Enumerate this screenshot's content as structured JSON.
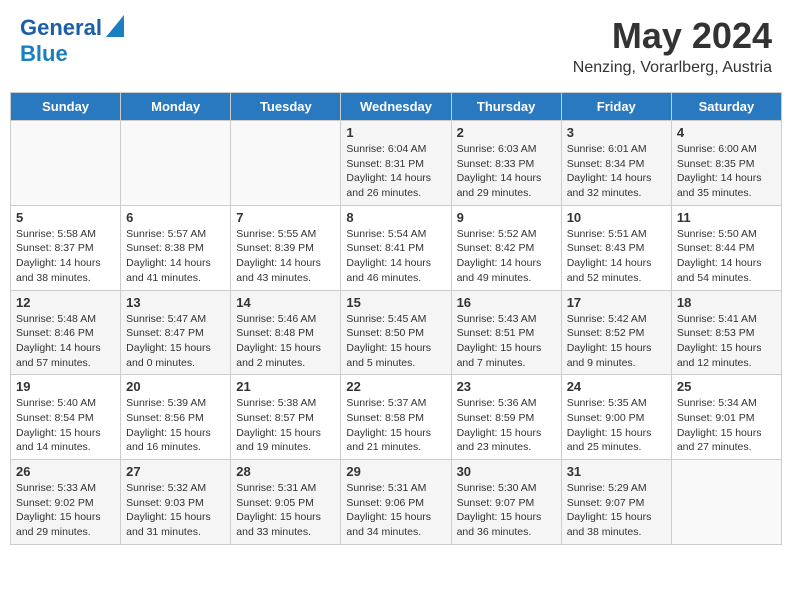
{
  "header": {
    "logo_line1": "General",
    "logo_line2": "Blue",
    "month_title": "May 2024",
    "location": "Nenzing, Vorarlberg, Austria"
  },
  "days_of_week": [
    "Sunday",
    "Monday",
    "Tuesday",
    "Wednesday",
    "Thursday",
    "Friday",
    "Saturday"
  ],
  "weeks": [
    [
      {
        "day": "",
        "info": ""
      },
      {
        "day": "",
        "info": ""
      },
      {
        "day": "",
        "info": ""
      },
      {
        "day": "1",
        "info": "Sunrise: 6:04 AM\nSunset: 8:31 PM\nDaylight: 14 hours and 26 minutes."
      },
      {
        "day": "2",
        "info": "Sunrise: 6:03 AM\nSunset: 8:33 PM\nDaylight: 14 hours and 29 minutes."
      },
      {
        "day": "3",
        "info": "Sunrise: 6:01 AM\nSunset: 8:34 PM\nDaylight: 14 hours and 32 minutes."
      },
      {
        "day": "4",
        "info": "Sunrise: 6:00 AM\nSunset: 8:35 PM\nDaylight: 14 hours and 35 minutes."
      }
    ],
    [
      {
        "day": "5",
        "info": "Sunrise: 5:58 AM\nSunset: 8:37 PM\nDaylight: 14 hours and 38 minutes."
      },
      {
        "day": "6",
        "info": "Sunrise: 5:57 AM\nSunset: 8:38 PM\nDaylight: 14 hours and 41 minutes."
      },
      {
        "day": "7",
        "info": "Sunrise: 5:55 AM\nSunset: 8:39 PM\nDaylight: 14 hours and 43 minutes."
      },
      {
        "day": "8",
        "info": "Sunrise: 5:54 AM\nSunset: 8:41 PM\nDaylight: 14 hours and 46 minutes."
      },
      {
        "day": "9",
        "info": "Sunrise: 5:52 AM\nSunset: 8:42 PM\nDaylight: 14 hours and 49 minutes."
      },
      {
        "day": "10",
        "info": "Sunrise: 5:51 AM\nSunset: 8:43 PM\nDaylight: 14 hours and 52 minutes."
      },
      {
        "day": "11",
        "info": "Sunrise: 5:50 AM\nSunset: 8:44 PM\nDaylight: 14 hours and 54 minutes."
      }
    ],
    [
      {
        "day": "12",
        "info": "Sunrise: 5:48 AM\nSunset: 8:46 PM\nDaylight: 14 hours and 57 minutes."
      },
      {
        "day": "13",
        "info": "Sunrise: 5:47 AM\nSunset: 8:47 PM\nDaylight: 15 hours and 0 minutes."
      },
      {
        "day": "14",
        "info": "Sunrise: 5:46 AM\nSunset: 8:48 PM\nDaylight: 15 hours and 2 minutes."
      },
      {
        "day": "15",
        "info": "Sunrise: 5:45 AM\nSunset: 8:50 PM\nDaylight: 15 hours and 5 minutes."
      },
      {
        "day": "16",
        "info": "Sunrise: 5:43 AM\nSunset: 8:51 PM\nDaylight: 15 hours and 7 minutes."
      },
      {
        "day": "17",
        "info": "Sunrise: 5:42 AM\nSunset: 8:52 PM\nDaylight: 15 hours and 9 minutes."
      },
      {
        "day": "18",
        "info": "Sunrise: 5:41 AM\nSunset: 8:53 PM\nDaylight: 15 hours and 12 minutes."
      }
    ],
    [
      {
        "day": "19",
        "info": "Sunrise: 5:40 AM\nSunset: 8:54 PM\nDaylight: 15 hours and 14 minutes."
      },
      {
        "day": "20",
        "info": "Sunrise: 5:39 AM\nSunset: 8:56 PM\nDaylight: 15 hours and 16 minutes."
      },
      {
        "day": "21",
        "info": "Sunrise: 5:38 AM\nSunset: 8:57 PM\nDaylight: 15 hours and 19 minutes."
      },
      {
        "day": "22",
        "info": "Sunrise: 5:37 AM\nSunset: 8:58 PM\nDaylight: 15 hours and 21 minutes."
      },
      {
        "day": "23",
        "info": "Sunrise: 5:36 AM\nSunset: 8:59 PM\nDaylight: 15 hours and 23 minutes."
      },
      {
        "day": "24",
        "info": "Sunrise: 5:35 AM\nSunset: 9:00 PM\nDaylight: 15 hours and 25 minutes."
      },
      {
        "day": "25",
        "info": "Sunrise: 5:34 AM\nSunset: 9:01 PM\nDaylight: 15 hours and 27 minutes."
      }
    ],
    [
      {
        "day": "26",
        "info": "Sunrise: 5:33 AM\nSunset: 9:02 PM\nDaylight: 15 hours and 29 minutes."
      },
      {
        "day": "27",
        "info": "Sunrise: 5:32 AM\nSunset: 9:03 PM\nDaylight: 15 hours and 31 minutes."
      },
      {
        "day": "28",
        "info": "Sunrise: 5:31 AM\nSunset: 9:05 PM\nDaylight: 15 hours and 33 minutes."
      },
      {
        "day": "29",
        "info": "Sunrise: 5:31 AM\nSunset: 9:06 PM\nDaylight: 15 hours and 34 minutes."
      },
      {
        "day": "30",
        "info": "Sunrise: 5:30 AM\nSunset: 9:07 PM\nDaylight: 15 hours and 36 minutes."
      },
      {
        "day": "31",
        "info": "Sunrise: 5:29 AM\nSunset: 9:07 PM\nDaylight: 15 hours and 38 minutes."
      },
      {
        "day": "",
        "info": ""
      }
    ]
  ]
}
